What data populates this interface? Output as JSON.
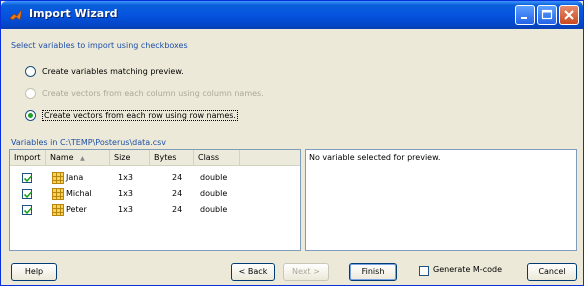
{
  "window": {
    "title": "Import Wizard"
  },
  "instructions": "Select variables to import using checkboxes",
  "options": [
    {
      "label": "Create variables matching preview.",
      "state": "enabled",
      "checked": false
    },
    {
      "label": "Create vectors from each column using column names.",
      "state": "disabled",
      "checked": false
    },
    {
      "label": "Create vectors from each row using row names.",
      "state": "enabled",
      "checked": true
    }
  ],
  "variables_label": "Variables in C:\\TEMP\\Posterus\\data.csv",
  "table": {
    "headers": {
      "import": "Import",
      "name": "Name",
      "sort_indicator": "▲",
      "size": "Size",
      "bytes": "Bytes",
      "class": "Class"
    },
    "rows": [
      {
        "checked": true,
        "name": "Jana",
        "size": "1x3",
        "bytes": "24",
        "class": "double"
      },
      {
        "checked": true,
        "name": "Michal",
        "size": "1x3",
        "bytes": "24",
        "class": "double"
      },
      {
        "checked": true,
        "name": "Peter",
        "size": "1x3",
        "bytes": "24",
        "class": "double"
      }
    ]
  },
  "preview": {
    "text": "No variable selected for preview."
  },
  "buttons": {
    "help": "Help",
    "back": "< Back",
    "next": "Next >",
    "finish": "Finish",
    "generate_label": "Generate M-code",
    "cancel": "Cancel"
  },
  "colors": {
    "titlebar": "#0554e0",
    "accent_text": "#1d4fa8",
    "window_bg": "#ece9d8"
  },
  "icons": {
    "app": "matlab-icon",
    "minimize": "minimize-icon",
    "maximize": "maximize-icon",
    "close": "close-icon",
    "variable": "grid-variable-icon"
  }
}
